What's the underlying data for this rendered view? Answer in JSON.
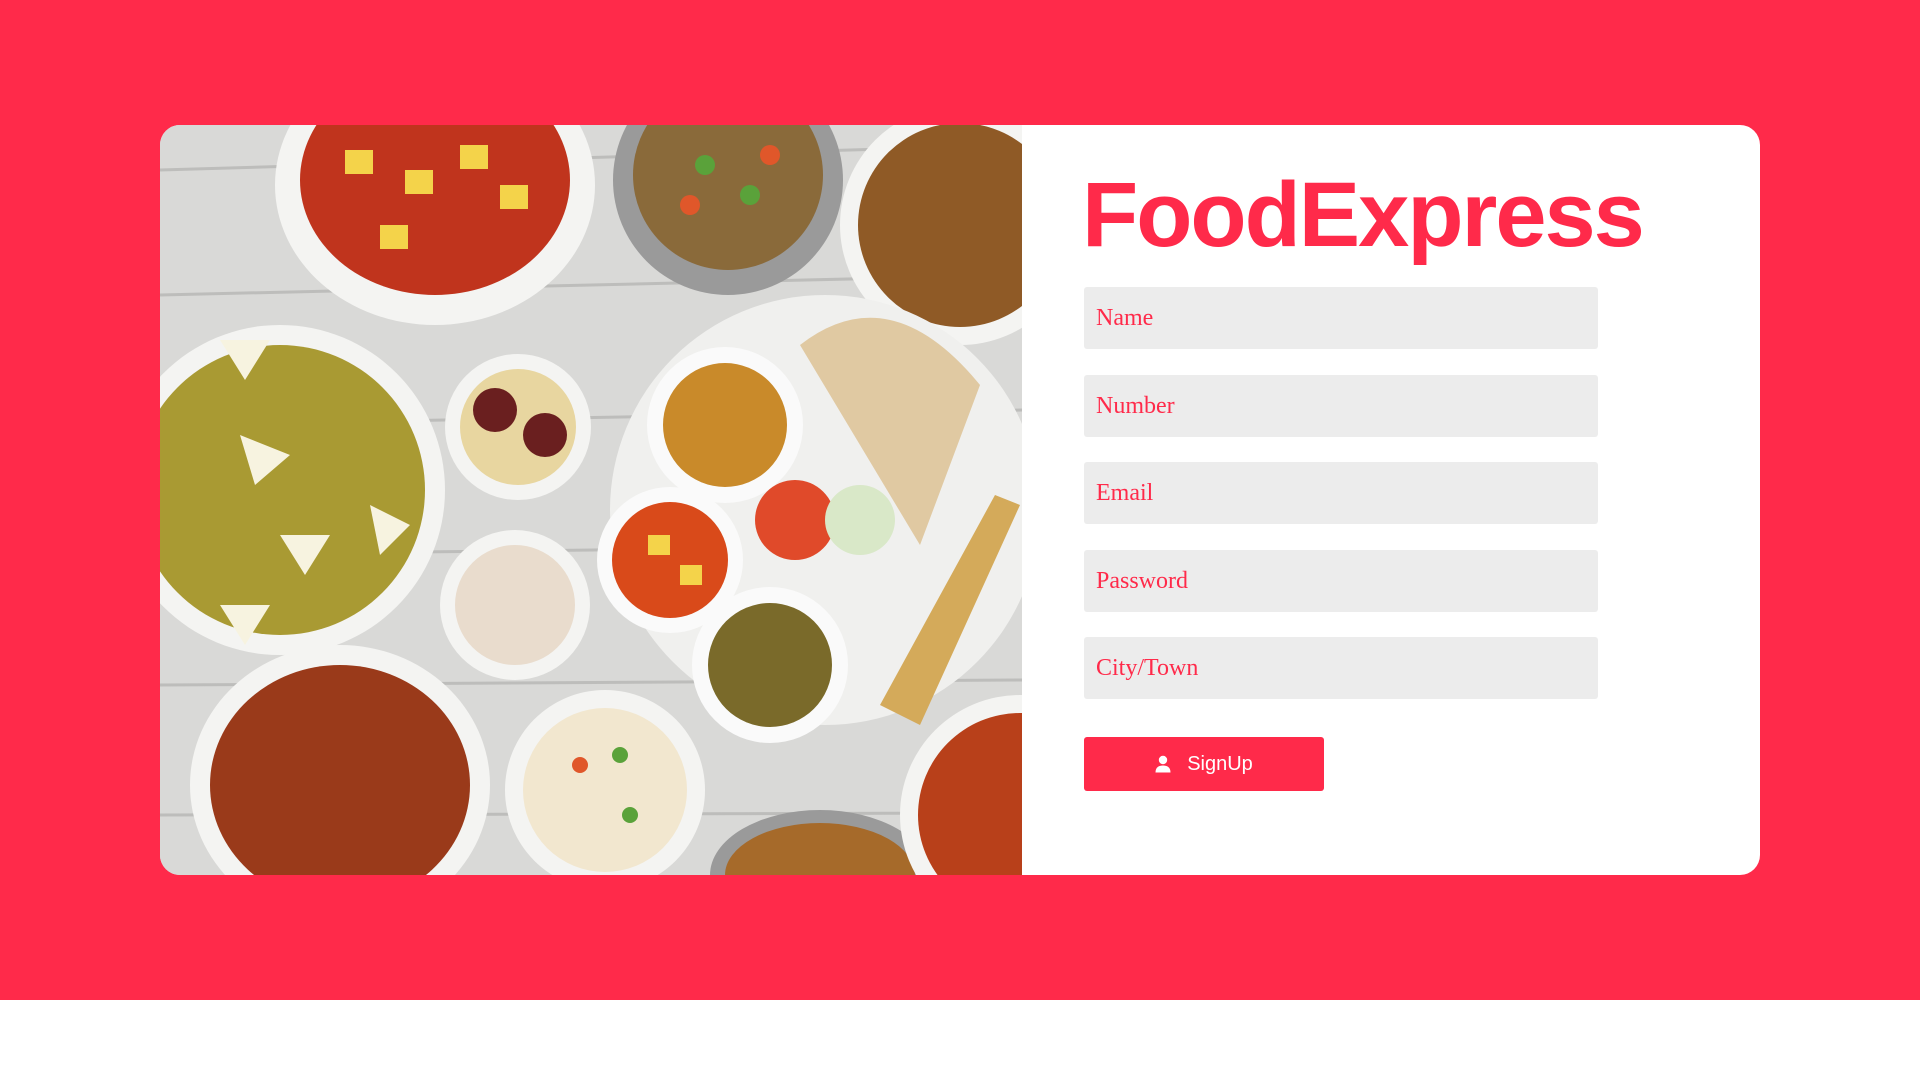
{
  "brand": {
    "title": "FoodExpress",
    "accent_color": "#ff2a4a"
  },
  "hero_image": {
    "description_icon": "food-platter-image"
  },
  "form": {
    "name_placeholder": "Name",
    "number_placeholder": "Number",
    "email_placeholder": "Email",
    "password_placeholder": "Password",
    "city_placeholder": "City/Town",
    "submit_label": "SignUp",
    "submit_icon": "user-icon"
  }
}
